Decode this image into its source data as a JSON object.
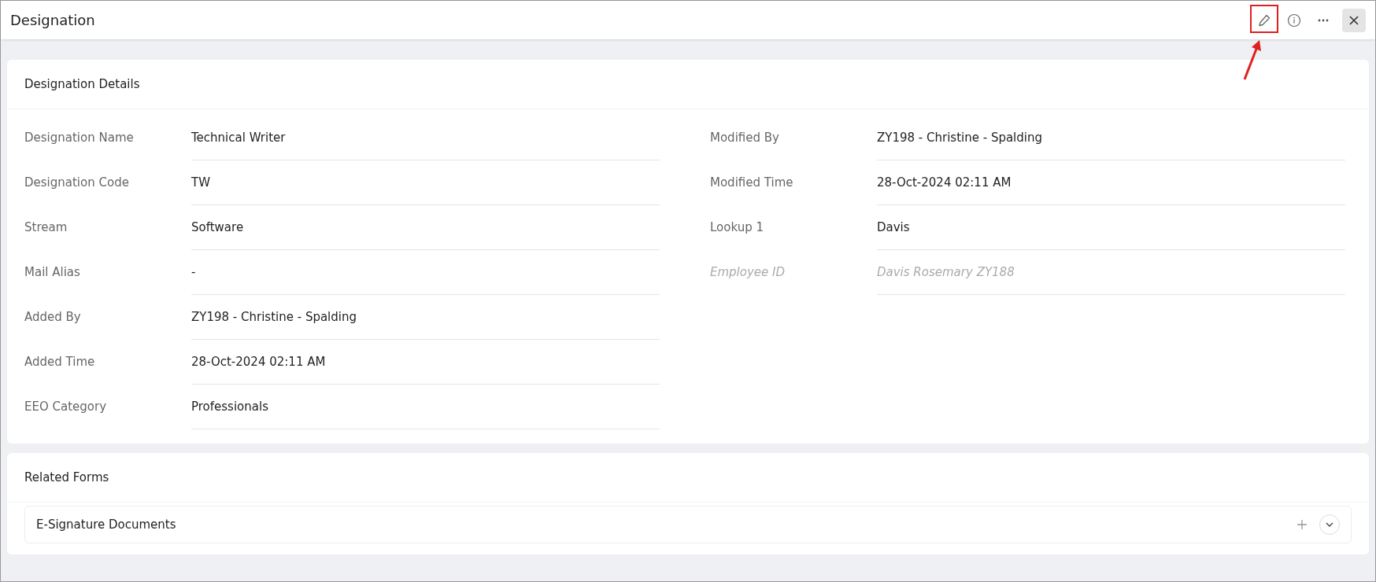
{
  "window": {
    "title": "Designation"
  },
  "details": {
    "title": "Designation Details",
    "left": [
      {
        "label": "Designation Name",
        "value": "Technical Writer",
        "disabled": false
      },
      {
        "label": "Designation Code",
        "value": "TW",
        "disabled": false
      },
      {
        "label": "Stream",
        "value": "Software",
        "disabled": false
      },
      {
        "label": "Mail Alias",
        "value": "-",
        "disabled": false
      },
      {
        "label": "Added By",
        "value": "ZY198 - Christine - Spalding",
        "disabled": false
      },
      {
        "label": "Added Time",
        "value": "28-Oct-2024 02:11 AM",
        "disabled": false
      },
      {
        "label": "EEO Category",
        "value": "Professionals",
        "disabled": false
      }
    ],
    "right": [
      {
        "label": "Modified By",
        "value": "ZY198 - Christine - Spalding",
        "disabled": false
      },
      {
        "label": "Modified Time",
        "value": "28-Oct-2024 02:11 AM",
        "disabled": false
      },
      {
        "label": "Lookup 1",
        "value": "Davis",
        "disabled": false
      },
      {
        "label": "Employee ID",
        "value": "Davis Rosemary ZY188",
        "disabled": true
      }
    ]
  },
  "related": {
    "title": "Related Forms",
    "forms": [
      {
        "title": "E-Signature Documents",
        "expanded": false
      }
    ]
  }
}
